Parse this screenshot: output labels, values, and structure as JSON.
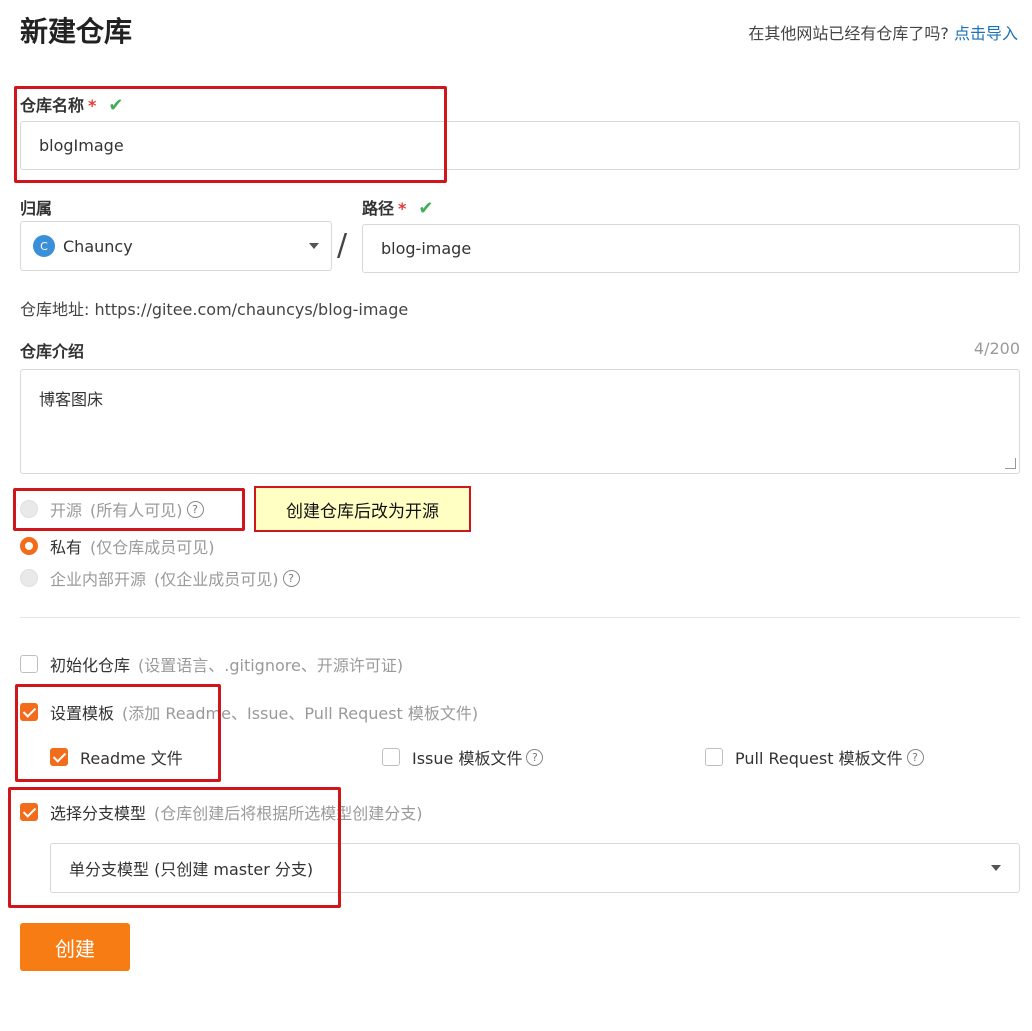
{
  "header": {
    "title": "新建仓库",
    "import_prompt": "在其他网站已经有仓库了吗?",
    "import_link": "点击导入"
  },
  "repo_name": {
    "label": "仓库名称",
    "required": "*",
    "value": "blogImage"
  },
  "owner": {
    "label": "归属",
    "avatar_letter": "C",
    "value": "Chauncy"
  },
  "separator": "/",
  "path": {
    "label": "路径",
    "required": "*",
    "value": "blog-image"
  },
  "repo_url": "仓库地址: https://gitee.com/chauncys/blog-image",
  "intro": {
    "label": "仓库介绍",
    "counter": "4/200",
    "value": "博客图床"
  },
  "visibility": {
    "open": {
      "label": "开源",
      "hint": "(所有人可见)"
    },
    "private": {
      "label": "私有",
      "hint": "(仅仓库成员可见)"
    },
    "internal": {
      "label": "企业内部开源",
      "hint": "(仅企业成员可见)"
    }
  },
  "tooltip": "创建仓库后改为开源",
  "init_repo": {
    "label": "初始化仓库",
    "hint": "(设置语言、.gitignore、开源许可证)"
  },
  "templates": {
    "label": "设置模板",
    "hint": "(添加 Readme、Issue、Pull Request 模板文件)",
    "readme": "Readme 文件",
    "issue": "Issue 模板文件",
    "pr": "Pull Request 模板文件"
  },
  "branch": {
    "label": "选择分支模型",
    "hint": "(仓库创建后将根据所选模型创建分支)",
    "value": "单分支模型 (只创建 master 分支)"
  },
  "create_button": "创建",
  "colors": {
    "accent": "#f77c14",
    "highlight": "#d0161b",
    "link": "#1a72b8"
  }
}
